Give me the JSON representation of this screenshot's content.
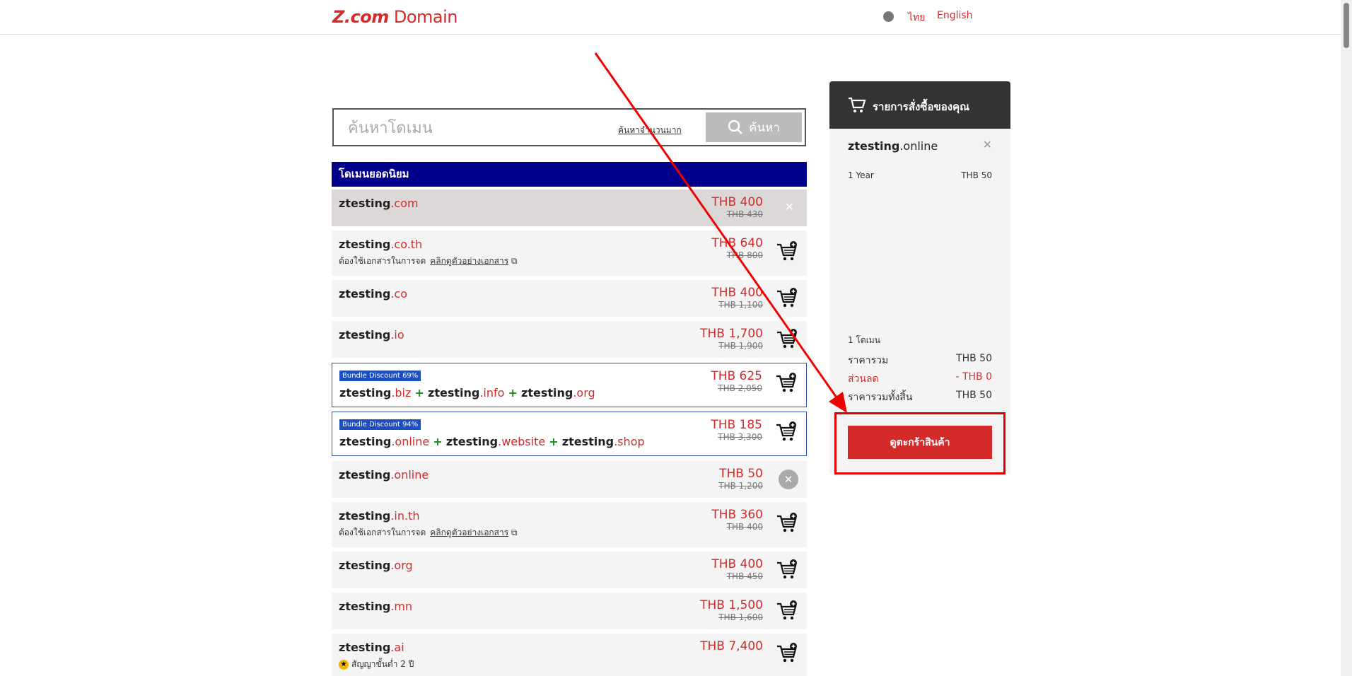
{
  "header": {
    "logo_brand": "Z.com",
    "logo_product": "Domain",
    "lang_thai": "ไทย",
    "lang_english": "English"
  },
  "search": {
    "placeholder": "ค้นหาโดเมน",
    "multi_link": "ค้นหาจำนวนมาก",
    "button_label": "ค้นหา"
  },
  "section_title": "โดเมนยอดนิยม",
  "domains": [
    {
      "name": "ztesting",
      "ext": ".com",
      "price": "THB 400",
      "old_price": "THB 430"
    },
    {
      "name": "ztesting",
      "ext": ".co.th",
      "price": "THB 640",
      "old_price": "THB 800",
      "note": "ต้องใช้เอกสารในการจด",
      "note_link": "คลิกดูตัวอย่างเอกสาร"
    },
    {
      "name": "ztesting",
      "ext": ".co",
      "price": "THB 400",
      "old_price": "THB 1,100"
    },
    {
      "name": "ztesting",
      "ext": ".io",
      "price": "THB 1,700",
      "old_price": "THB 1,900"
    },
    {
      "name": "ztesting",
      "ext": ".online",
      "price": "THB 50",
      "old_price": "THB 1,200"
    },
    {
      "name": "ztesting",
      "ext": ".in.th",
      "price": "THB 360",
      "old_price": "THB 400",
      "note": "ต้องใช้เอกสารในการจด",
      "note_link": "คลิกดูตัวอย่างเอกสาร"
    },
    {
      "name": "ztesting",
      "ext": ".org",
      "price": "THB 400",
      "old_price": "THB 450"
    },
    {
      "name": "ztesting",
      "ext": ".mn",
      "price": "THB 1,500",
      "old_price": "THB 1,600"
    },
    {
      "name": "ztesting",
      "ext": ".ai",
      "price": "THB 7,400",
      "note": "สัญญาขั้นต่ำ 2 ปี"
    }
  ],
  "bundles": [
    {
      "badge": "Bundle Discount 69%",
      "names": [
        "ztesting",
        "ztesting",
        "ztesting"
      ],
      "exts": [
        ".biz",
        ".info",
        ".org"
      ],
      "price": "THB 625",
      "old_price": "THB 2,050"
    },
    {
      "badge": "Bundle Discount 94%",
      "names": [
        "ztesting",
        "ztesting",
        "ztesting"
      ],
      "exts": [
        ".online",
        ".website",
        ".shop"
      ],
      "price": "THB 185",
      "old_price": "THB 3,300"
    }
  ],
  "plus_sign": "+",
  "cart_panel": {
    "title": "รายการสั่งซื้อของคุณ",
    "item_name": "ztesting",
    "item_ext": ".online",
    "item_period": "1 Year",
    "item_price": "THB 50",
    "count": "1 โดเมน",
    "subtotal_label": "ราคารวม",
    "subtotal": "THB 50",
    "discount_label": "ส่วนลด",
    "discount": "- THB 0",
    "total_label": "ราคารวมทั้งสิ้น",
    "total": "THB 50",
    "checkout_label": "ดูตะกร้าสินค้า"
  },
  "colors": {
    "brand_red": "#d52a2a",
    "section_navy": "#00008b",
    "bundle_badge_blue": "#1c4ec2",
    "panel_header": "#333333",
    "annotation_red": "#e00000"
  }
}
